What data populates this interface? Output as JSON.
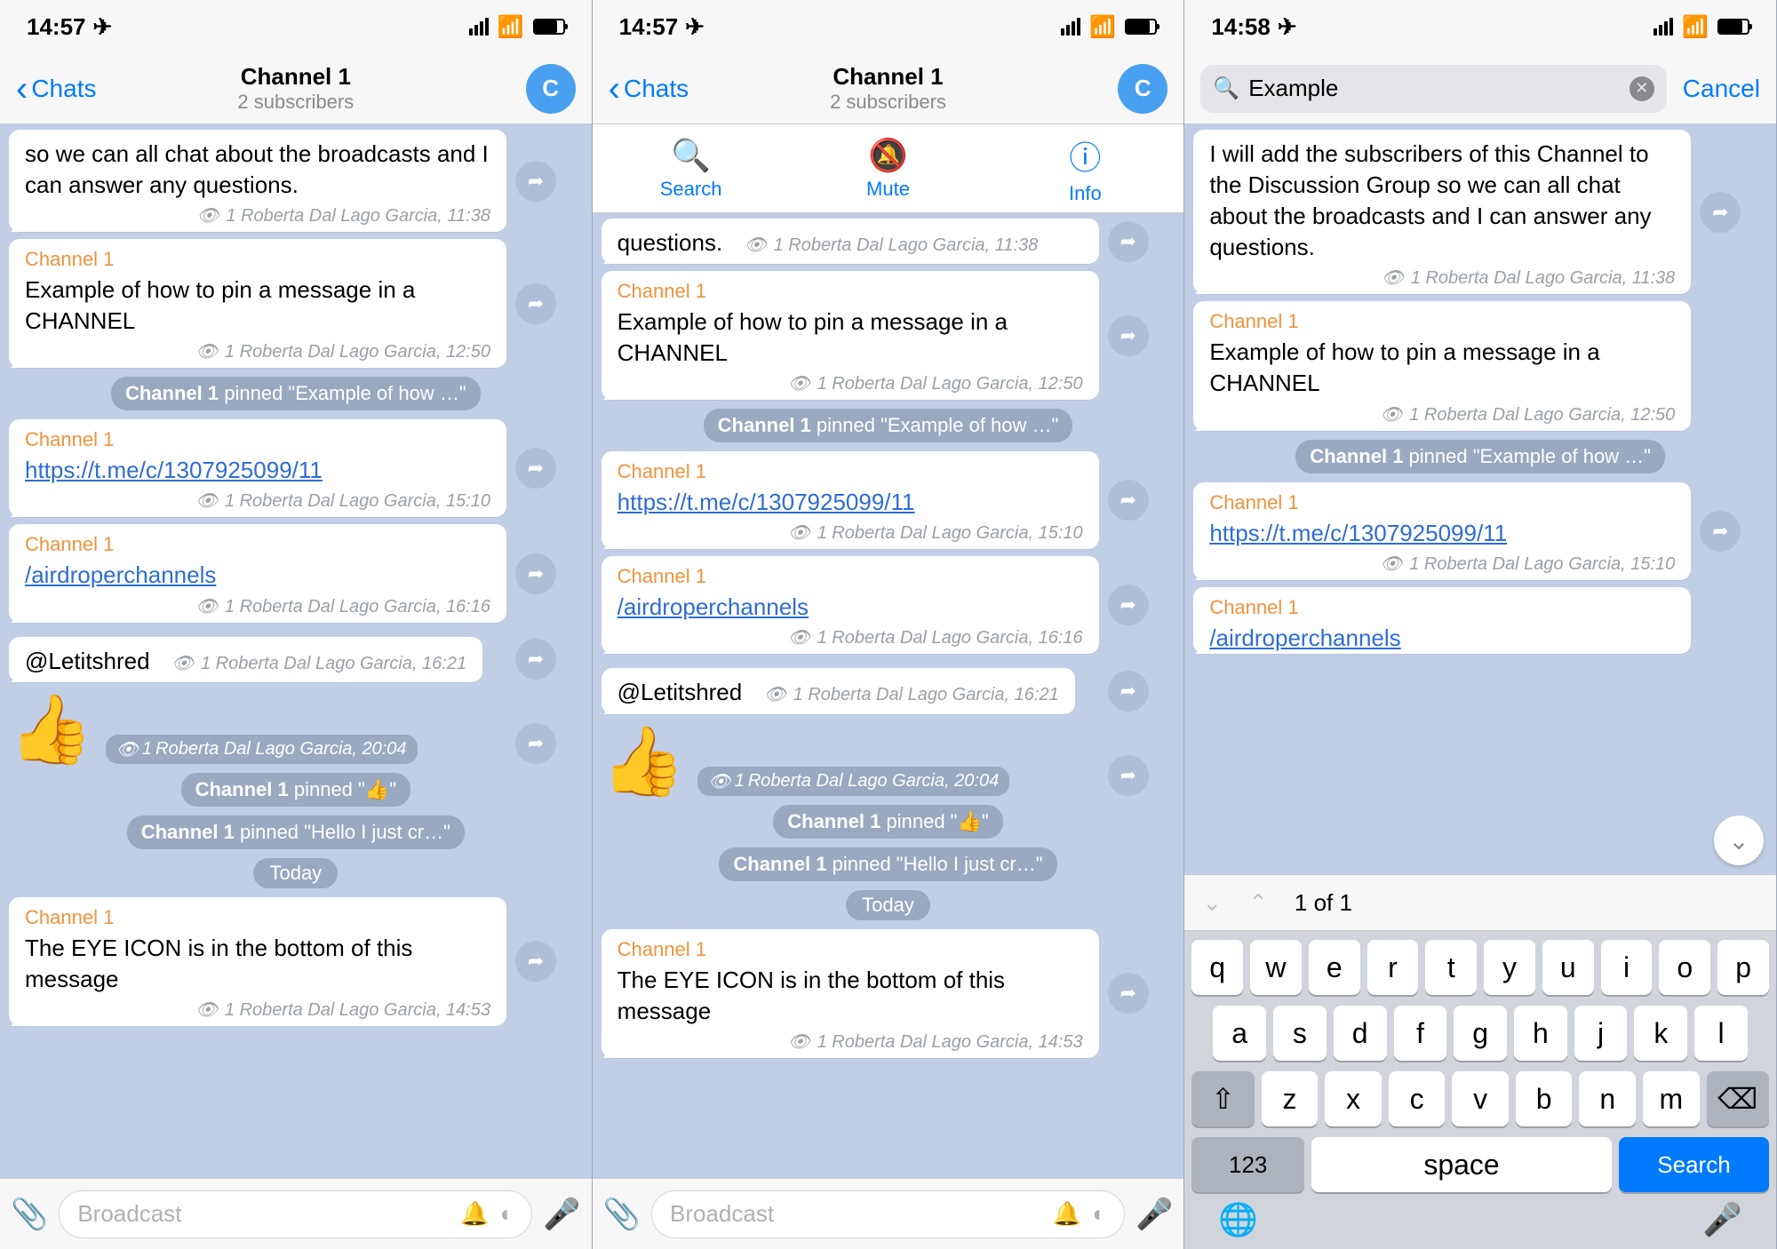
{
  "status": {
    "time_ab": "14:57",
    "time_c": "14:58",
    "location_arrow": "➤"
  },
  "nav": {
    "back": "Chats",
    "title": "Channel 1",
    "subtitle": "2 subscribers",
    "avatar_letter": "C"
  },
  "actions": {
    "search": "Search",
    "mute": "Mute",
    "info": "Info"
  },
  "search": {
    "value": "Example",
    "cancel": "Cancel"
  },
  "results": {
    "count": "1 of 1"
  },
  "compose": {
    "placeholder": "Broadcast"
  },
  "messages": {
    "partial_a": {
      "text": "so we can all chat about the broadcasts and I can answer any questions.",
      "views": "1",
      "meta": "Roberta Dal Lago Garcia, 11:38"
    },
    "partial_b": {
      "text": "questions.",
      "views": "1",
      "meta": "Roberta Dal Lago Garcia, 11:38"
    },
    "full_intro": {
      "text": "I will add the subscribers of this Channel to the Discussion Group so we can all chat about the broadcasts and I can answer any questions.",
      "views": "1",
      "meta": "Roberta Dal Lago Garcia, 11:38"
    },
    "example": {
      "sender": "Channel 1",
      "text": "Example of how to pin a message in a CHANNEL",
      "views": "1",
      "meta": "Roberta Dal Lago Garcia, 12:50"
    },
    "pinned1": {
      "b": "Channel 1",
      "t": " pinned \"Example of how …\""
    },
    "link1": {
      "sender": "Channel 1",
      "url": "https://t.me/c/1307925099/11",
      "views": "1",
      "meta": "Roberta Dal Lago Garcia, 15:10"
    },
    "link2": {
      "sender": "Channel 1",
      "url": "/airdroperchannels",
      "views": "1",
      "meta": "Roberta Dal Lago Garcia, 16:16"
    },
    "mention": {
      "text": "@Letitshred",
      "views": "1",
      "meta": "Roberta Dal Lago Garcia, 16:21"
    },
    "emoji": {
      "emoji": "👍",
      "views": "1",
      "meta": "Roberta Dal Lago Garcia, 20:04"
    },
    "pinned2": {
      "b": "Channel 1",
      "t": " pinned \"👍\""
    },
    "pinned3": {
      "b": "Channel 1",
      "t": " pinned \"Hello I just cr…\""
    },
    "today": "Today",
    "eye": {
      "sender": "Channel 1",
      "text": "The EYE ICON is in the bottom of this message",
      "views": "1",
      "meta": "Roberta Dal Lago Garcia, 14:53"
    }
  },
  "keyboard": {
    "row1": [
      "q",
      "w",
      "e",
      "r",
      "t",
      "y",
      "u",
      "i",
      "o",
      "p"
    ],
    "row2": [
      "a",
      "s",
      "d",
      "f",
      "g",
      "h",
      "j",
      "k",
      "l"
    ],
    "row3": [
      "z",
      "x",
      "c",
      "v",
      "b",
      "n",
      "m"
    ],
    "num": "123",
    "space": "space",
    "search": "Search"
  }
}
